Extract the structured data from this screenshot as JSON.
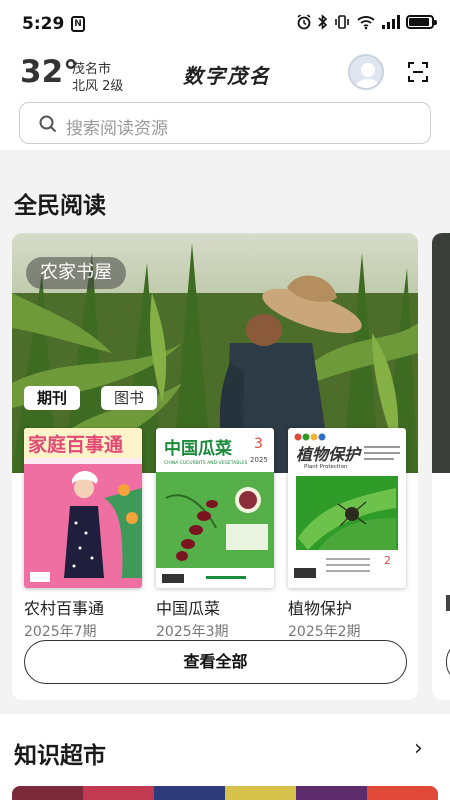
{
  "status_bar": {
    "time": "5:29",
    "badge": "N",
    "icons": [
      "alarm-icon",
      "bluetooth-icon",
      "vibrate-icon",
      "wifi-icon",
      "signal-icon"
    ],
    "battery_level": 0.9
  },
  "header": {
    "weather": {
      "temperature": "32°",
      "city": "茂名市",
      "description": "北风 2级"
    },
    "app_title": "数字茂名"
  },
  "search": {
    "placeholder": "搜索阅读资源"
  },
  "reading": {
    "title": "全民阅读",
    "hero_tag": "农家书屋",
    "chips": {
      "active": "期刊",
      "idle": "图书"
    },
    "books": [
      {
        "title": "农村百事通",
        "issue": "2025年7期",
        "cover_text": "家庭百事通",
        "cover_color": "#e84c82"
      },
      {
        "title": "中国瓜菜",
        "issue": "2025年3期",
        "cover_text": "中国瓜菜",
        "cover_sub": "CHINA CUCURBITS AND VEGETABLES",
        "cover_num": "3",
        "cover_year": "2025",
        "cover_color": "#1a8a3b"
      },
      {
        "title": "植物保护",
        "issue": "2025年2期",
        "cover_text": "植物保护",
        "cover_sub": "Plant Protection",
        "cover_num": "2",
        "cover_color": "#2f9c2a"
      }
    ],
    "view_all": "查看全部"
  },
  "market": {
    "title": "知识超市",
    "chevron": "›"
  }
}
